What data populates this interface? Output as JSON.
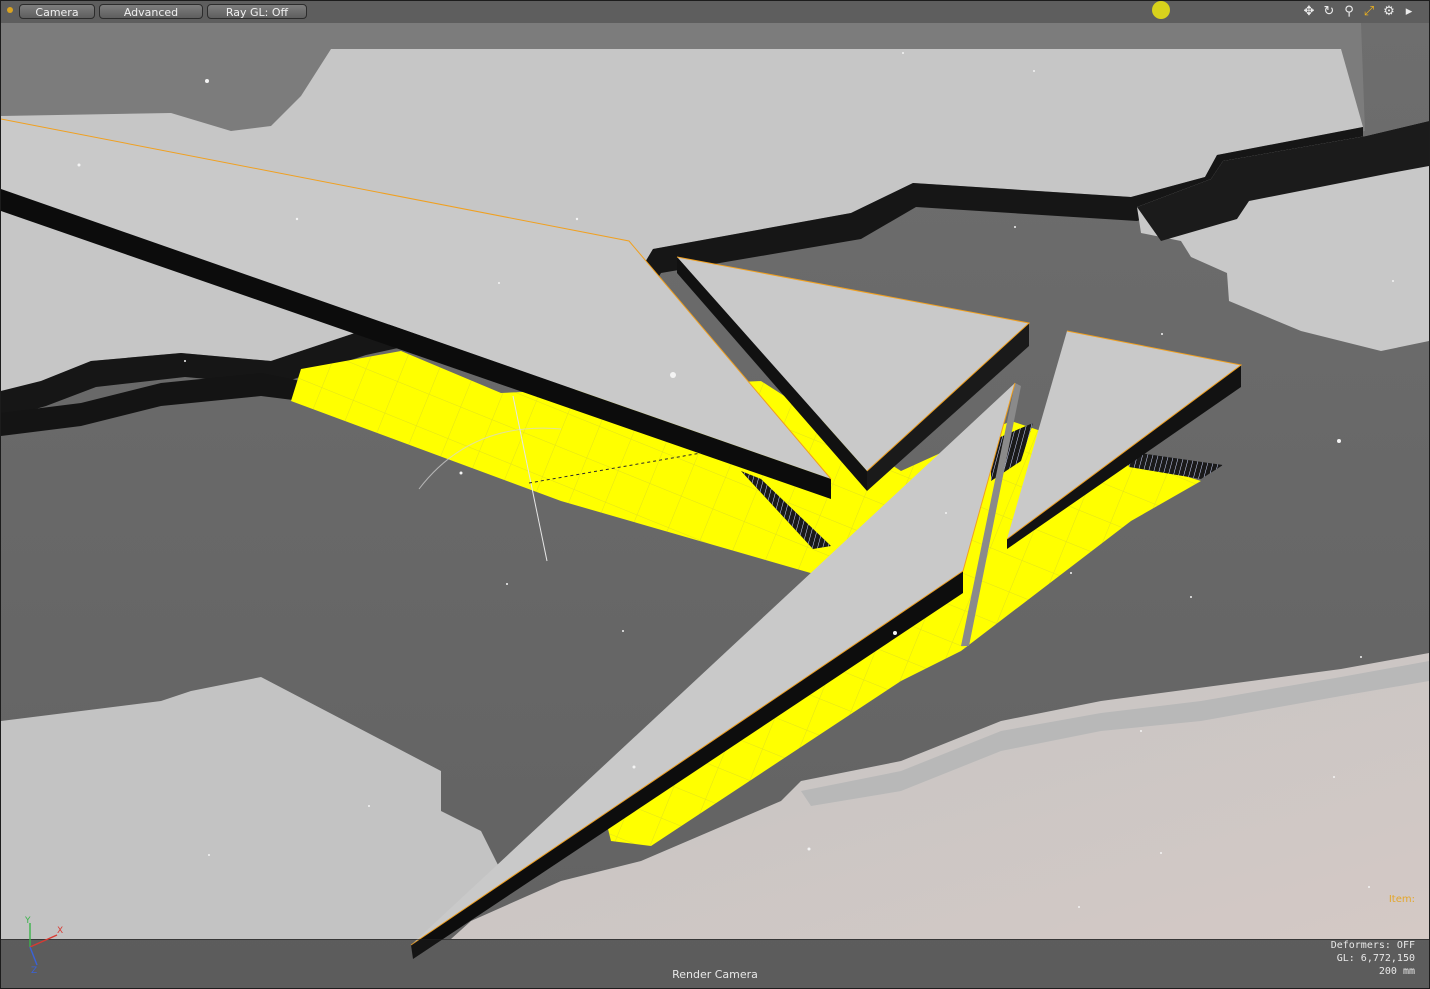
{
  "toolbar": {
    "camera_label": "Camera",
    "advanced_label": "Advanced",
    "raygl_label": "Ray GL: Off"
  },
  "viewport_icons": [
    {
      "name": "move-view-icon",
      "glyph": "✥"
    },
    {
      "name": "rotate-view-icon",
      "glyph": "↻"
    },
    {
      "name": "zoom-view-icon",
      "glyph": "⚲"
    },
    {
      "name": "fit-view-icon",
      "glyph": "⤢"
    },
    {
      "name": "viewport-settings-gear-icon",
      "glyph": "⚙"
    },
    {
      "name": "expand-arrow-icon",
      "glyph": "▸"
    }
  ],
  "status": {
    "view_label": "Render Camera",
    "deformers": "Deformers: OFF",
    "gl_count": "GL: 6,772,150",
    "grid_size": "200 mm",
    "item_name": "Item:",
    "item_sub": ""
  },
  "axis": {
    "x": "X",
    "y": "Y",
    "z": "Z"
  },
  "colors": {
    "selection_yellow": "#ffff00",
    "surface_gray": "#c7c7c7",
    "ground_gray": "#666666",
    "edge_orange": "#f0a020",
    "light_yellow": "#d8d21c"
  }
}
